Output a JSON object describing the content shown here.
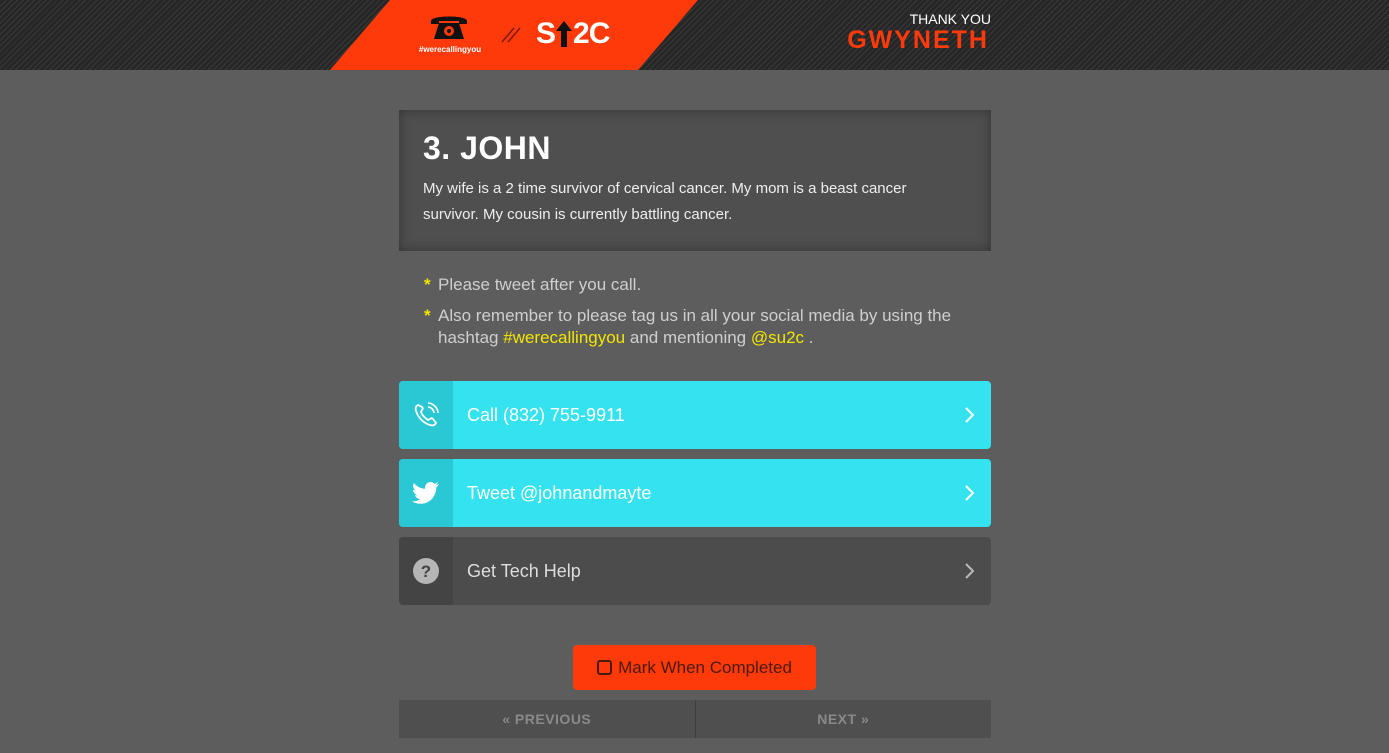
{
  "header": {
    "hashtag": "#werecallingyou",
    "brand": "SU2C",
    "thanks_label": "THANK YOU",
    "thanks_name": "GWYNETH",
    "accent_color": "#ff3a0a"
  },
  "card": {
    "title": "3. JOHN",
    "story": "My wife is a 2 time survivor of cervical cancer. My mom is a beast cancer survivor. My cousin is currently battling cancer."
  },
  "notes": {
    "star": "*",
    "note1": "Please tweet after you call.",
    "note2_pre": "Also remember to please tag us in all your social media by using the hashtag",
    "note2_hashtag": "#werecallingyou",
    "note2_mid": "and mentioning",
    "note2_handle": "@su2c",
    "note2_end": "."
  },
  "actions": {
    "call": {
      "label": "Call (832) 755-9911",
      "icon": "phone-icon"
    },
    "tweet": {
      "label": "Tweet @johnandmayte",
      "icon": "twitter-icon"
    },
    "help": {
      "label": "Get Tech Help",
      "icon": "help-icon"
    }
  },
  "mark_complete": {
    "label": "Mark When Completed",
    "checked": false
  },
  "pager": {
    "previous": "« PREVIOUS",
    "next": "NEXT »"
  }
}
